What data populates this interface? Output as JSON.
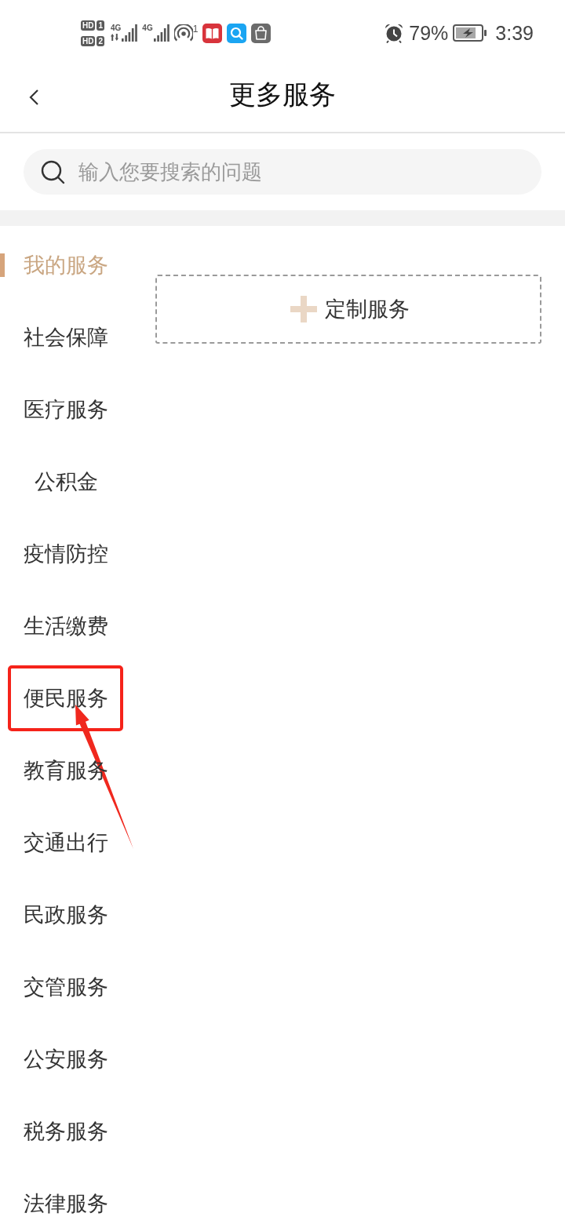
{
  "status_bar": {
    "sims": [
      {
        "badge": "HD",
        "slot": "1",
        "network": "4G",
        "data_active": true
      },
      {
        "badge": "HD",
        "slot": "2",
        "network": "4G",
        "data_active": false
      }
    ],
    "hotspot_count": "1",
    "battery": "79%",
    "time": "3:39"
  },
  "header": {
    "title": "更多服务"
  },
  "search": {
    "placeholder": "输入您要搜索的问题"
  },
  "sidebar": {
    "items": [
      {
        "label": "我的服务",
        "selected": true,
        "highlighted": false
      },
      {
        "label": "社会保障",
        "selected": false,
        "highlighted": false
      },
      {
        "label": "医疗服务",
        "selected": false,
        "highlighted": false
      },
      {
        "label": "公积金",
        "selected": false,
        "highlighted": false
      },
      {
        "label": "疫情防控",
        "selected": false,
        "highlighted": false
      },
      {
        "label": "生活缴费",
        "selected": false,
        "highlighted": false
      },
      {
        "label": "便民服务",
        "selected": false,
        "highlighted": true
      },
      {
        "label": "教育服务",
        "selected": false,
        "highlighted": false
      },
      {
        "label": "交通出行",
        "selected": false,
        "highlighted": false
      },
      {
        "label": "民政服务",
        "selected": false,
        "highlighted": false
      },
      {
        "label": "交管服务",
        "selected": false,
        "highlighted": false
      },
      {
        "label": "公安服务",
        "selected": false,
        "highlighted": false
      },
      {
        "label": "税务服务",
        "selected": false,
        "highlighted": false
      },
      {
        "label": "法律服务",
        "selected": false,
        "highlighted": false
      }
    ]
  },
  "content": {
    "add_button": {
      "label": "定制服务"
    }
  }
}
